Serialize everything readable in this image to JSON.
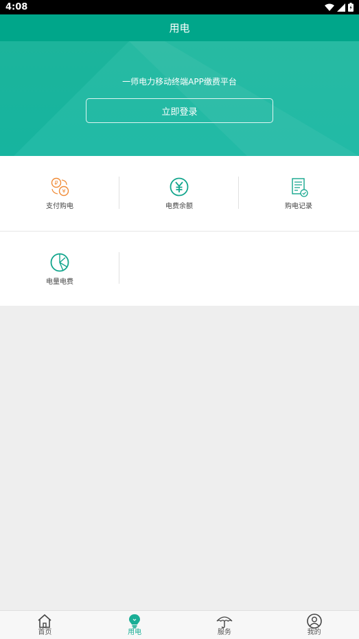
{
  "status_bar": {
    "time": "4:08"
  },
  "header": {
    "title": "用电"
  },
  "banner": {
    "subtitle": "一师电力移动终端APP缴费平台",
    "login_label": "立即登录"
  },
  "grid": {
    "items": [
      {
        "label": "支付购电",
        "icon": "pay-exchange-icon"
      },
      {
        "label": "电费余额",
        "icon": "yuan-icon"
      },
      {
        "label": "购电记录",
        "icon": "record-icon"
      },
      {
        "label": "电量电费",
        "icon": "pie-chart-icon"
      }
    ]
  },
  "bottom_nav": {
    "items": [
      {
        "label": "首页",
        "icon": "home-icon"
      },
      {
        "label": "用电",
        "icon": "bulb-icon",
        "active": true
      },
      {
        "label": "服务",
        "icon": "umbrella-icon"
      },
      {
        "label": "我的",
        "icon": "user-icon"
      }
    ]
  },
  "colors": {
    "primary": "#00a68a",
    "banner": "#19b8a3",
    "accent_orange": "#f08a35",
    "active_tab": "#1aae96"
  }
}
